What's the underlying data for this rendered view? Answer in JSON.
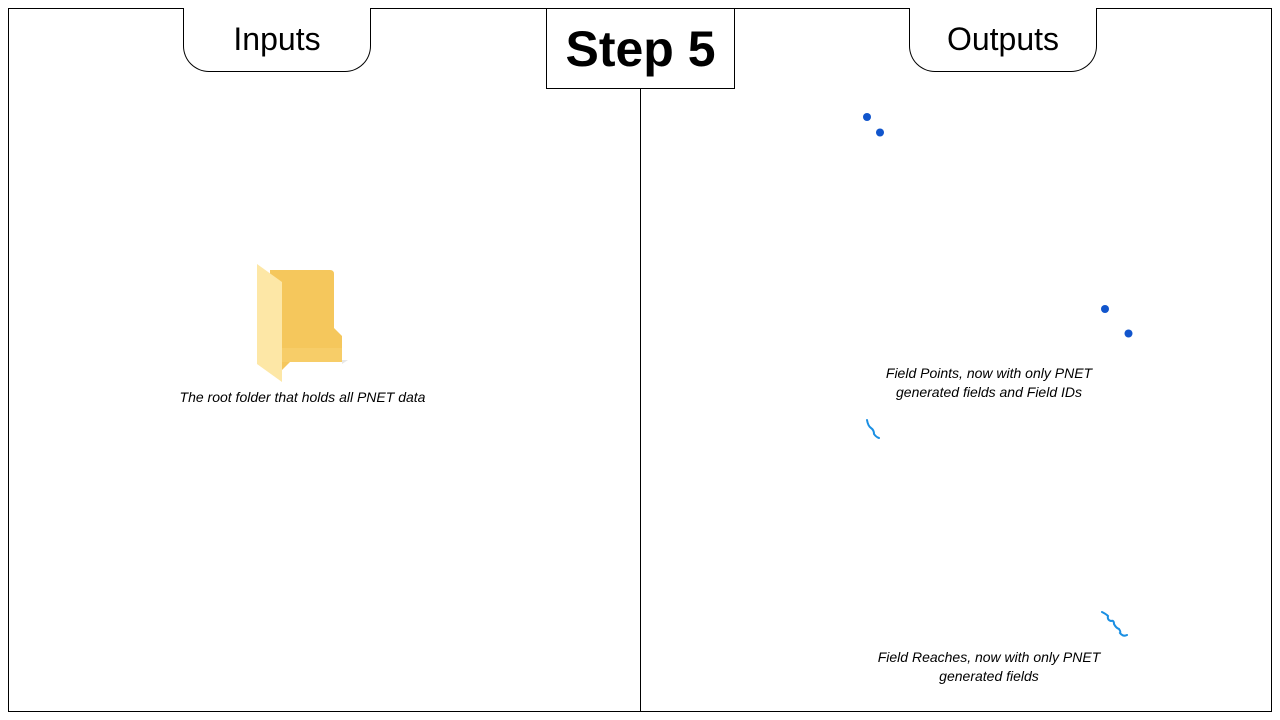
{
  "title": "Step 5",
  "inputs": {
    "tab_label": "Inputs",
    "folder_caption": "The root folder that holds all PNET data"
  },
  "outputs": {
    "tab_label": "Outputs",
    "field_points_caption_line1": "Field Points, now with only PNET",
    "field_points_caption_line2": "generated fields and Field IDs",
    "field_reaches_caption_line1": "Field Reaches, now with only PNET",
    "field_reaches_caption_line2": "generated fields"
  },
  "icons": {
    "folder": "folder-icon",
    "points": "point-features-icon",
    "lines": "line-features-icon"
  },
  "colors": {
    "point": "#1155cc",
    "line": "#1a8fe3",
    "folder_front": "#fcd97a",
    "folder_back": "#f5c75c"
  }
}
